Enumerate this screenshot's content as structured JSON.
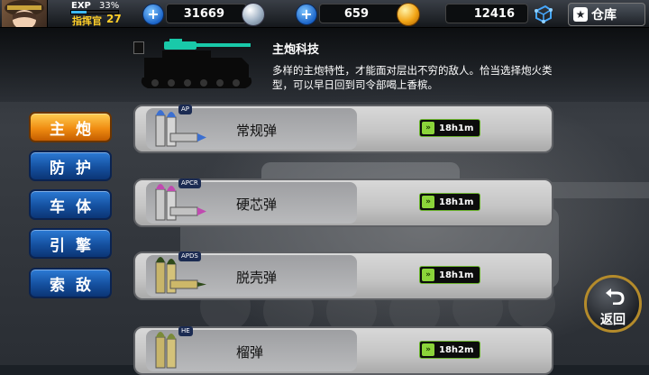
{
  "player": {
    "exp_label": "EXP",
    "exp_percent": "33%",
    "exp_fraction": 0.33,
    "rank_label": "指挥官",
    "rank_level": "27"
  },
  "resources": {
    "silver": "31669",
    "gold": "659",
    "crystals": "12416"
  },
  "depot_label": "仓库",
  "tech": {
    "title": "主炮科技",
    "description": "多样的主炮特性，才能面对层出不穷的敌人。恰当选择炮火类型，可以早日回到司令部喝上香槟。"
  },
  "tabs": [
    {
      "label": "主炮",
      "active": true
    },
    {
      "label": "防护",
      "active": false
    },
    {
      "label": "车体",
      "active": false
    },
    {
      "label": "引擎",
      "active": false
    },
    {
      "label": "索敌",
      "active": false
    }
  ],
  "shells": [
    {
      "tag": "AP",
      "name": "常规弹",
      "time": "18h1m"
    },
    {
      "tag": "APCR",
      "name": "硬芯弹",
      "time": "18h1m"
    },
    {
      "tag": "APDS",
      "name": "脱壳弹",
      "time": "18h1m"
    },
    {
      "tag": "HE",
      "name": "榴弹",
      "time": "18h2m"
    }
  ],
  "back_label": "返回",
  "colors": {
    "tab_active": "#f08d12",
    "tab_inactive": "#15509f",
    "timer_green": "#8bd43a",
    "accent_teal": "#19c9a9"
  }
}
